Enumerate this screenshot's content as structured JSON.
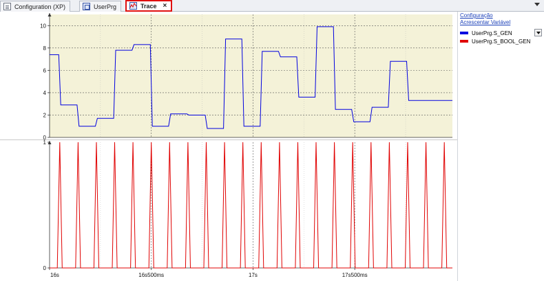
{
  "tabs": [
    {
      "label": "Configuration (XP)",
      "icon": "document-icon",
      "active": false
    },
    {
      "label": "UserPrg",
      "icon": "program-icon",
      "active": false
    },
    {
      "label": "Trace",
      "icon": "trace-icon",
      "active": true,
      "close": "×"
    }
  ],
  "side": {
    "config_link": "Configuração",
    "add_var_link": "Acrescentar Variável",
    "legend": [
      {
        "name": "UserPrg.S_GEN",
        "color": "#0000e0"
      },
      {
        "name": "UserPrg.S_BOOL_GEN",
        "color": "#e00000"
      }
    ]
  },
  "colors": {
    "upper_plot_bg": "#f4f2d8",
    "lower_plot_bg": "#ffffff",
    "s_gen": "#0000e0",
    "s_bool_gen": "#e00000"
  },
  "chart_data": [
    {
      "type": "line",
      "series": [
        {
          "name": "UserPrg.S_GEN",
          "x": [
            16.0,
            16.045,
            16.055,
            16.135,
            16.145,
            16.225,
            16.235,
            16.315,
            16.325,
            16.405,
            16.415,
            16.495,
            16.505,
            16.585,
            16.595,
            16.675,
            16.685,
            16.765,
            16.775,
            16.855,
            16.865,
            16.945,
            16.955,
            17.035,
            17.045,
            17.125,
            17.135,
            17.215,
            17.225,
            17.305,
            17.315,
            17.395,
            17.405,
            17.485,
            17.495,
            17.575,
            17.585,
            17.665,
            17.675,
            17.755,
            17.765,
            17.845,
            17.855,
            17.935,
            17.945,
            17.98
          ],
          "values": [
            7.4,
            7.4,
            2.9,
            2.9,
            1.0,
            1.0,
            1.7,
            1.7,
            7.8,
            7.8,
            8.3,
            8.3,
            1.0,
            1.0,
            2.1,
            2.1,
            2.0,
            2.0,
            0.8,
            0.8,
            8.8,
            8.8,
            1.0,
            1.0,
            7.7,
            7.7,
            7.2,
            7.2,
            3.6,
            3.6,
            9.9,
            9.9,
            2.5,
            2.5,
            1.4,
            1.4,
            2.7,
            2.7,
            6.8,
            6.8,
            3.3,
            3.3,
            3.3,
            3.3,
            3.3,
            3.3
          ],
          "color": "#0000e0"
        }
      ],
      "xlim": [
        16.0,
        17.98
      ],
      "ylim": [
        0,
        11
      ],
      "yticks": [
        0,
        2,
        4,
        6,
        8,
        10
      ],
      "grid": true
    },
    {
      "type": "line",
      "series": [
        {
          "name": "UserPrg.S_BOOL_GEN",
          "pulse_centers": [
            16.05,
            16.14,
            16.23,
            16.32,
            16.41,
            16.5,
            16.59,
            16.68,
            16.77,
            16.86,
            16.95,
            17.04,
            17.13,
            17.22,
            17.31,
            17.4,
            17.49,
            17.58,
            17.67,
            17.76,
            17.85,
            17.94
          ],
          "pulse_half_width": 0.012,
          "low": 0,
          "high": 1,
          "color": "#e00000"
        }
      ],
      "xlim": [
        16.0,
        17.98
      ],
      "ylim": [
        0,
        1
      ],
      "yticks": [
        0,
        1
      ],
      "xticks": [
        16.0,
        16.5,
        17.0,
        17.5
      ],
      "xtick_labels": [
        "16s",
        "16s500ms",
        "17s",
        "17s500ms"
      ],
      "grid": true
    }
  ]
}
